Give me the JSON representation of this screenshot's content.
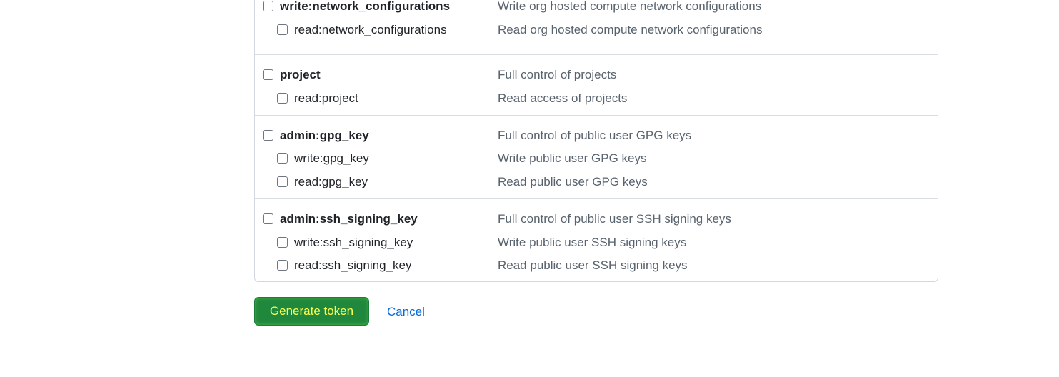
{
  "scope_groups": [
    {
      "rows": [
        {
          "name": "write:network_configurations",
          "desc": "Write org hosted compute network configurations"
        },
        {
          "name": "read:network_configurations",
          "desc": "Read org hosted compute network configurations"
        }
      ]
    },
    {
      "rows": [
        {
          "name": "project",
          "desc": "Full control of projects"
        },
        {
          "name": "read:project",
          "desc": "Read access of projects"
        }
      ]
    },
    {
      "rows": [
        {
          "name": "admin:gpg_key",
          "desc": "Full control of public user GPG keys"
        },
        {
          "name": "write:gpg_key",
          "desc": "Write public user GPG keys"
        },
        {
          "name": "read:gpg_key",
          "desc": "Read public user GPG keys"
        }
      ]
    },
    {
      "rows": [
        {
          "name": "admin:ssh_signing_key",
          "desc": "Full control of public user SSH signing keys"
        },
        {
          "name": "write:ssh_signing_key",
          "desc": "Write public user SSH signing keys"
        },
        {
          "name": "read:ssh_signing_key",
          "desc": "Read public user SSH signing keys"
        }
      ]
    }
  ],
  "actions": {
    "generate_label": "Generate token",
    "cancel_label": "Cancel"
  },
  "colors": {
    "primary_button": "#1f883d",
    "primary_button_text": "#ffff4d",
    "link": "#0969da",
    "border": "#d0d7de",
    "muted_text": "#59636e"
  }
}
